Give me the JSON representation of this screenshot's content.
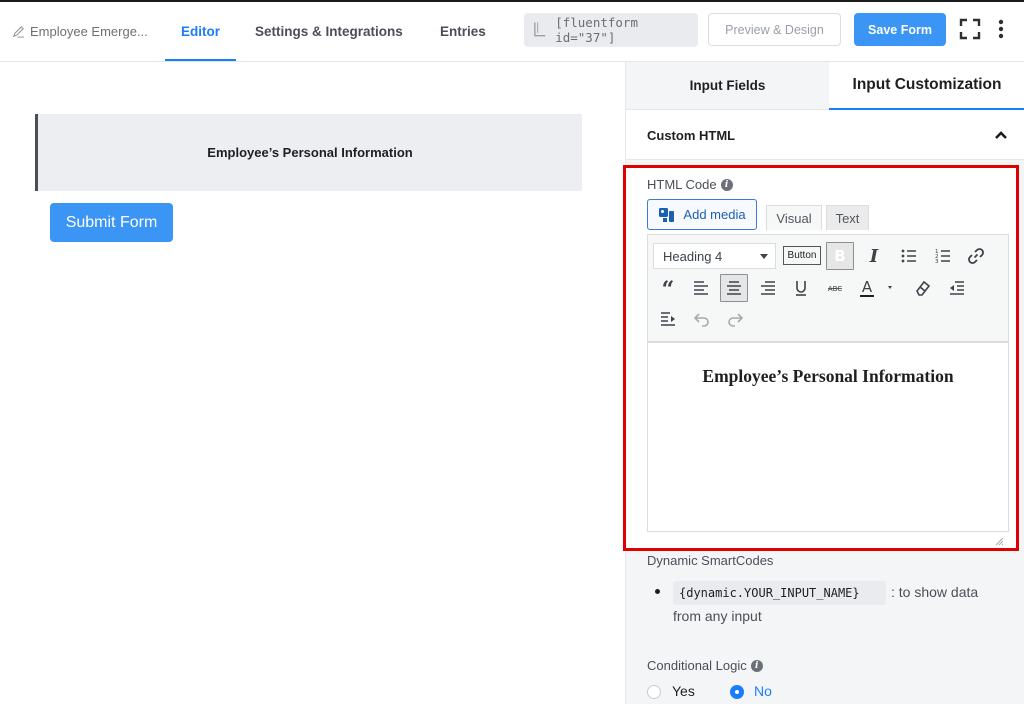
{
  "topbar": {
    "form_title": "Employee Emerge...",
    "tabs": [
      {
        "label": "Editor",
        "active": true
      },
      {
        "label": "Settings & Integrations",
        "active": false
      },
      {
        "label": "Entries",
        "active": false
      }
    ],
    "shortcode": "[fluentform id=\"37\"]",
    "preview_label": "Preview & Design",
    "save_label": "Save Form"
  },
  "canvas": {
    "section_title": "Employee’s Personal Information",
    "submit_label": "Submit Form"
  },
  "panel": {
    "tabs": [
      {
        "label": "Input Fields",
        "active": false
      },
      {
        "label": "Input Customization",
        "active": true
      }
    ],
    "accordion_title": "Custom HTML",
    "html_code_label": "HTML Code",
    "add_media_label": "Add media",
    "editor_tabs": [
      {
        "label": "Visual",
        "active": true
      },
      {
        "label": "Text",
        "active": false
      }
    ],
    "format_select": "Heading 4",
    "button_label": "Button",
    "editor_content": "Employee’s Personal Information",
    "smartcodes_title": "Dynamic SmartCodes",
    "smartcode": "{dynamic.YOUR_INPUT_NAME}",
    "smartcode_desc_1": ": to show data",
    "smartcode_desc_2": "from any input",
    "conditional_label": "Conditional Logic",
    "radio_yes": "Yes",
    "radio_no": "No",
    "conditional_value": "No"
  },
  "colors": {
    "accent": "#1a7efb",
    "primary_button": "#3a95f5",
    "highlight_border": "#e00000"
  }
}
